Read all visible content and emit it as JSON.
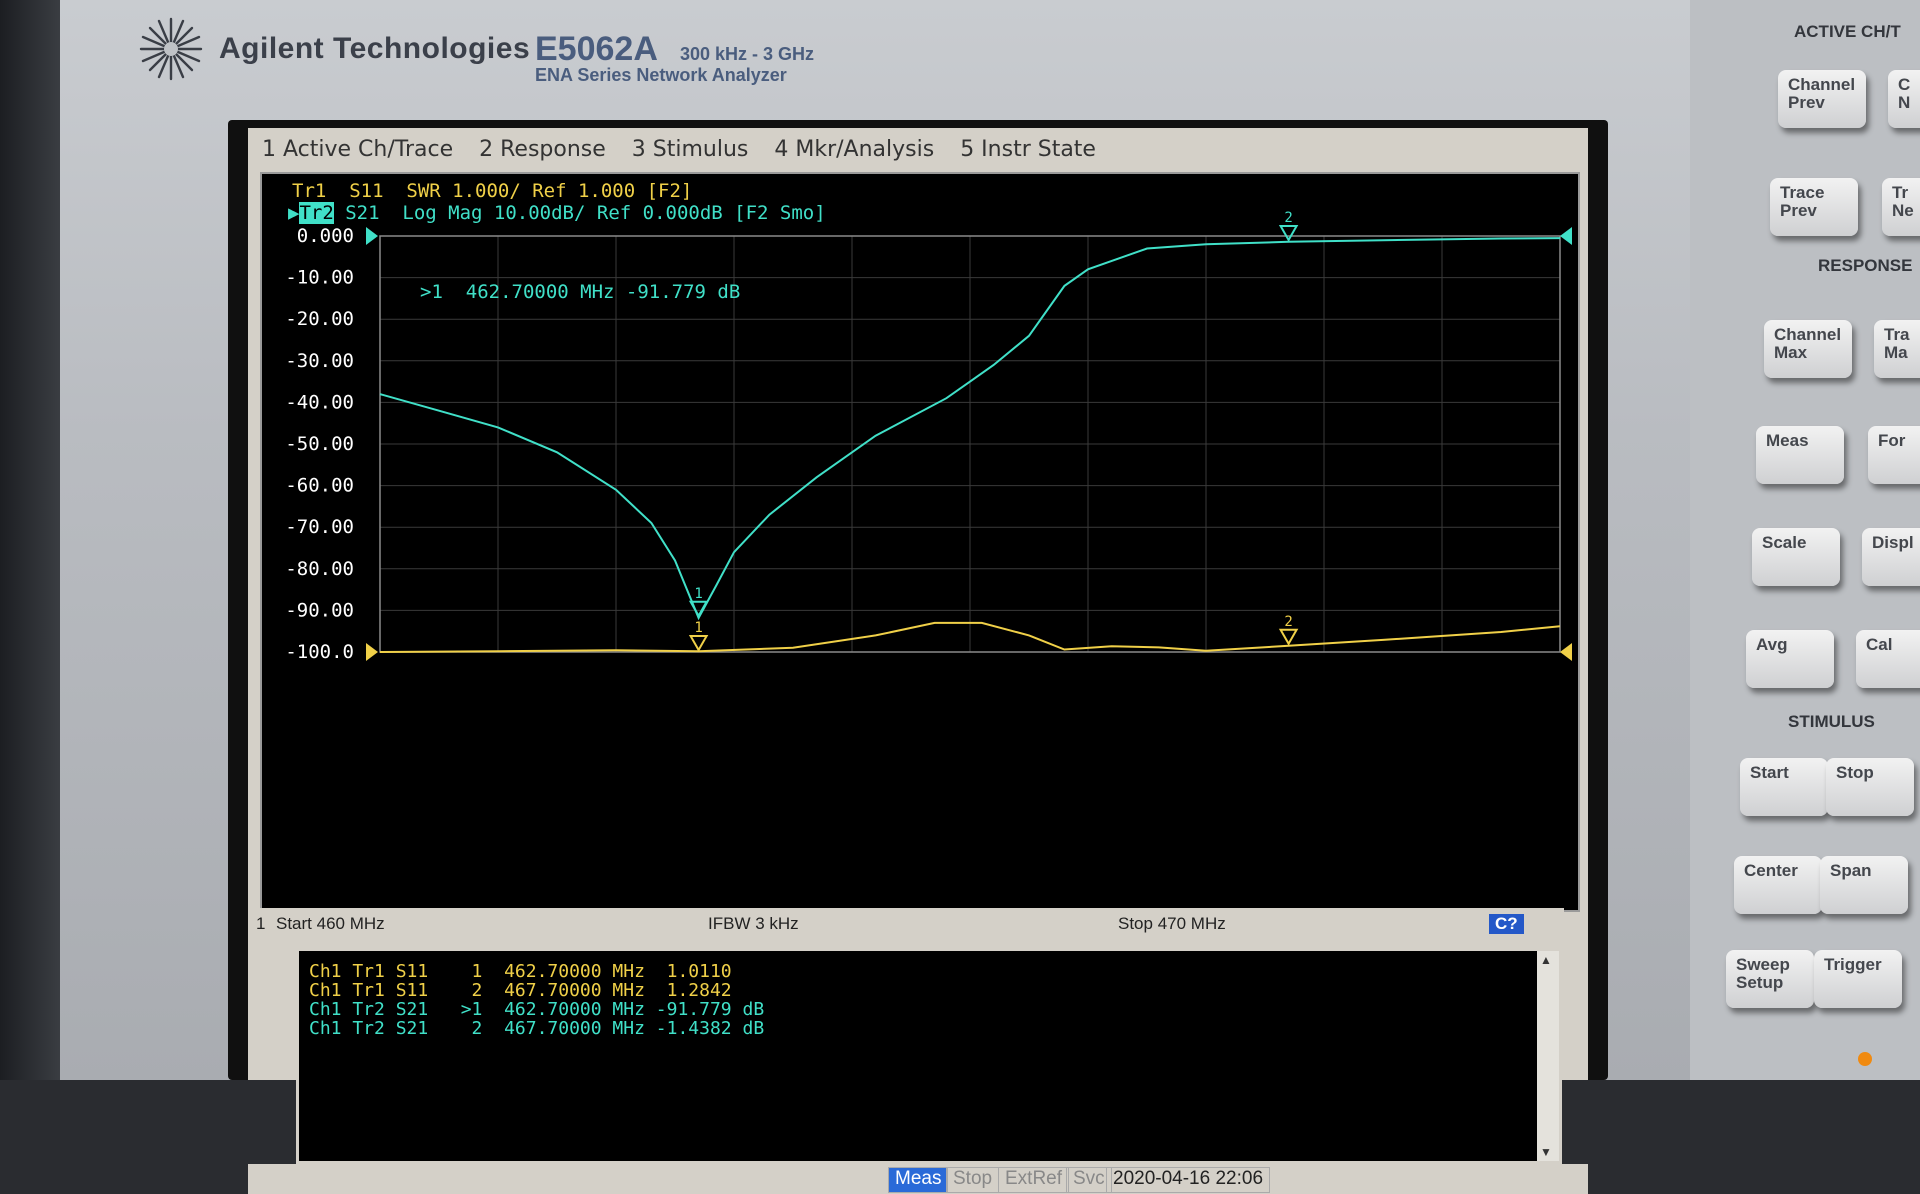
{
  "brand": {
    "name": "Agilent Technologies"
  },
  "model": {
    "name": "E5062A",
    "range": "300 kHz - 3 GHz",
    "subtitle": "ENA Series Network Analyzer"
  },
  "menu": [
    "1 Active Ch/Trace",
    "2 Response",
    "3 Stimulus",
    "4 Mkr/Analysis",
    "5 Instr State"
  ],
  "trace_headers": {
    "tr1": "Tr1  S11  SWR 1.000/ Ref 1.000 [F2]",
    "tr2_label": "Tr2",
    "tr2_rest": " S21  Log Mag 10.00dB/ Ref 0.000dB [F2 Smo]"
  },
  "active_marker_readout": ">1  462.70000 MHz -91.779 dB",
  "footer": {
    "channel": "1",
    "start": "Start 460 MHz",
    "ifbw": "IFBW 3 kHz",
    "stop": "Stop 470 MHz",
    "badge": "C?"
  },
  "marker_table": [
    {
      "text": "Ch1 Tr1 S11    1  462.70000 MHz  1.0110",
      "color": "#f0d048"
    },
    {
      "text": "Ch1 Tr1 S11    2  467.70000 MHz  1.2842",
      "color": "#f0d048"
    },
    {
      "text": "Ch1 Tr2 S21   >1  462.70000 MHz -91.779 dB",
      "color": "#40e0c8"
    },
    {
      "text": "Ch1 Tr2 S21    2  467.70000 MHz -1.4382 dB",
      "color": "#40e0c8"
    }
  ],
  "status_bar": {
    "meas": "Meas",
    "stop": "Stop",
    "extref": "ExtRef",
    "svc": "Svc",
    "datetime": "2020-04-16 22:06"
  },
  "panel": {
    "sections": {
      "active": "ACTIVE CH/T",
      "response": "RESPONSE",
      "stimulus": "STIMULUS"
    },
    "keys": [
      {
        "id": "channel-prev",
        "label": "Channel\nPrev"
      },
      {
        "id": "trace-prev",
        "label": "Trace\nPrev"
      },
      {
        "id": "channel-max",
        "label": "Channel\nMax"
      },
      {
        "id": "meas",
        "label": "Meas"
      },
      {
        "id": "scale",
        "label": "Scale"
      },
      {
        "id": "avg",
        "label": "Avg"
      },
      {
        "id": "start",
        "label": "Start"
      },
      {
        "id": "stop",
        "label": "Stop"
      },
      {
        "id": "center",
        "label": "Center"
      },
      {
        "id": "span",
        "label": "Span"
      },
      {
        "id": "sweep-setup",
        "label": "Sweep\nSetup"
      },
      {
        "id": "trigger",
        "label": "Trigger"
      },
      {
        "id": "col2-a",
        "label": "C\nN"
      },
      {
        "id": "col2-b",
        "label": "Tr\nNe"
      },
      {
        "id": "col2-c",
        "label": "Tra\nMa"
      },
      {
        "id": "col2-d",
        "label": "For"
      },
      {
        "id": "col2-e",
        "label": "Displ"
      },
      {
        "id": "col2-f",
        "label": "Cal"
      }
    ]
  },
  "colors": {
    "s11": "#f0d048",
    "s21": "#40e0c8",
    "grid": "#3a3a3a"
  },
  "chart_data": {
    "type": "line",
    "y_tick_labels": [
      "0.000",
      "-10.00",
      "-20.00",
      "-30.00",
      "-40.00",
      "-50.00",
      "-60.00",
      "-70.00",
      "-80.00",
      "-90.00",
      "-100.0"
    ],
    "xlim": [
      460,
      470
    ],
    "ylim": [
      -100,
      0
    ],
    "series": [
      {
        "name": "S21",
        "color": "#40e0c8",
        "x": [
          460.0,
          460.5,
          461.0,
          461.5,
          462.0,
          462.3,
          462.5,
          462.7,
          462.85,
          463.0,
          463.3,
          463.7,
          464.2,
          464.8,
          465.2,
          465.5,
          465.8,
          466.0,
          466.3,
          466.5,
          467.0,
          467.7,
          468.5,
          469.5,
          470.0
        ],
        "y": [
          -38,
          -42,
          -46,
          -52,
          -61,
          -69,
          -78,
          -91.8,
          -84,
          -76,
          -67,
          -58,
          -48,
          -39,
          -31,
          -24,
          -12,
          -8,
          -5,
          -3,
          -2,
          -1.4,
          -1.0,
          -0.6,
          -0.5
        ]
      },
      {
        "name": "S11",
        "color": "#f0d048",
        "x": [
          460.0,
          461.0,
          462.0,
          462.7,
          463.5,
          464.2,
          464.7,
          465.1,
          465.5,
          465.8,
          466.2,
          466.6,
          467.0,
          467.7,
          468.5,
          469.5,
          470.0
        ],
        "y": [
          -100,
          -99.8,
          -99.6,
          -99.8,
          -99,
          -96,
          -93,
          -93,
          -96,
          -99.4,
          -98.6,
          -98.9,
          -99.7,
          -98.5,
          -97.1,
          -95.2,
          -93.8
        ]
      }
    ],
    "markers": [
      {
        "trace": "S21",
        "id": "1",
        "x": 462.7,
        "y": -91.779
      },
      {
        "trace": "S21",
        "id": "2",
        "x": 467.7,
        "y": -1.4382
      },
      {
        "trace": "S11",
        "id": "1",
        "x": 462.7,
        "y": -100
      },
      {
        "trace": "S11",
        "id": "2",
        "x": 467.7,
        "y": -98.5
      }
    ]
  }
}
